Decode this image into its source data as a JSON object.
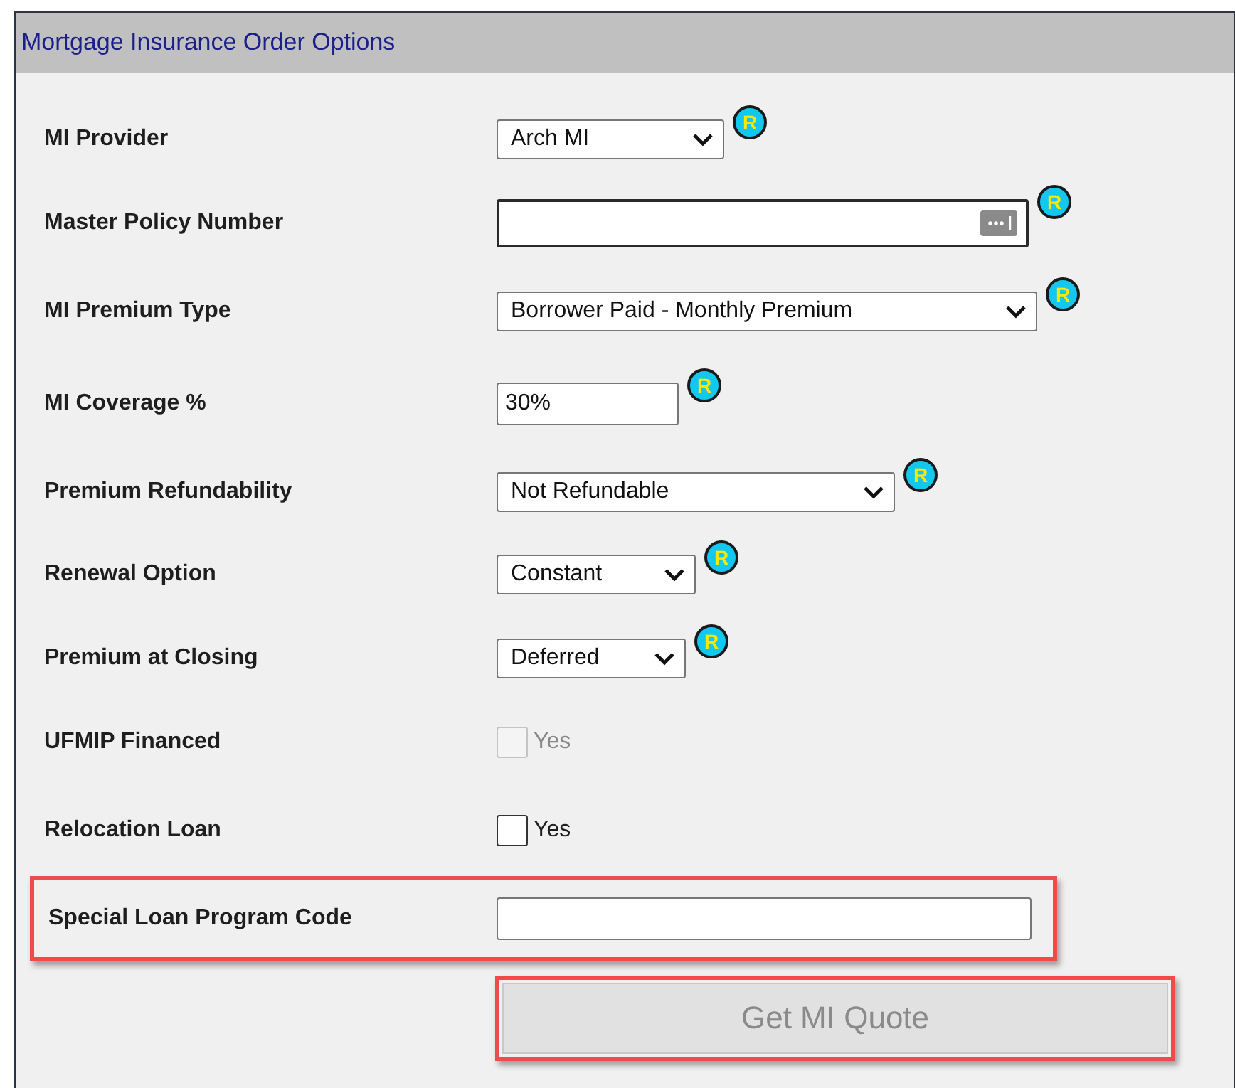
{
  "panel": {
    "title": "Mortgage Insurance Order Options"
  },
  "fields": [
    {
      "kind": "select",
      "label": "MI Provider",
      "value": "Arch MI",
      "help": "R"
    },
    {
      "kind": "input",
      "label": "Master Policy Number",
      "help": "R",
      "picker": true,
      "focused": true
    },
    {
      "kind": "select",
      "label": "MI Premium Type",
      "value": "Borrower Paid - Monthly Premium",
      "help": "R"
    },
    {
      "kind": "input",
      "label": "MI Coverage %",
      "value": "30%",
      "help": "R",
      "picker": false,
      "focused": false
    },
    {
      "kind": "select",
      "label": "Premium Refundability",
      "value": "Not Refundable",
      "help": "R"
    },
    {
      "kind": "select",
      "label": "Renewal Option",
      "value": "Constant",
      "help": "R"
    },
    {
      "kind": "select",
      "label": "Premium at Closing",
      "value": "Deferred",
      "help": "R"
    },
    {
      "kind": "checkbox",
      "label": "UFMIP Financed",
      "option": "Yes",
      "checked": false,
      "disabled": true
    },
    {
      "kind": "checkbox",
      "label": "Relocation Loan",
      "option": "Yes",
      "checked": false,
      "disabled": false
    },
    {
      "kind": "input",
      "label": "Special Loan Program Code",
      "picker": false,
      "focused": false,
      "highlighted": true
    }
  ],
  "quote_button": {
    "label": "Get MI Quote",
    "disabled": true,
    "highlighted": true
  }
}
